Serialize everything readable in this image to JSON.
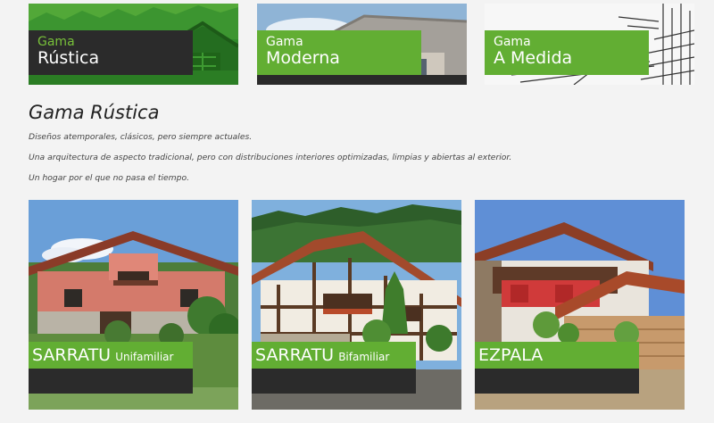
{
  "categories": [
    {
      "line1": "Gama",
      "line2": "Rústica",
      "style": "dark"
    },
    {
      "line1": "Gama",
      "line2": "Moderna",
      "style": "green"
    },
    {
      "line1": "Gama",
      "line2": "A Medida",
      "style": "green"
    }
  ],
  "section": {
    "title": "Gama Rústica",
    "paragraphs": [
      "Diseños atemporales, clásicos, pero siempre actuales.",
      "Una arquitectura de aspecto tradicional, pero con distribuciones interiores optimizadas, limpias y abiertas al exterior.",
      "Un hogar por el que no pasa el tiempo."
    ]
  },
  "models": [
    {
      "name": "SARRATU",
      "sub": "Unifamiliar"
    },
    {
      "name": "SARRATU",
      "sub": "Bifamiliar"
    },
    {
      "name": "EZPALA",
      "sub": ""
    }
  ],
  "colors": {
    "accent_green": "#62ae33",
    "dark_label": "#2b2b2b",
    "background": "#f3f3f3"
  }
}
